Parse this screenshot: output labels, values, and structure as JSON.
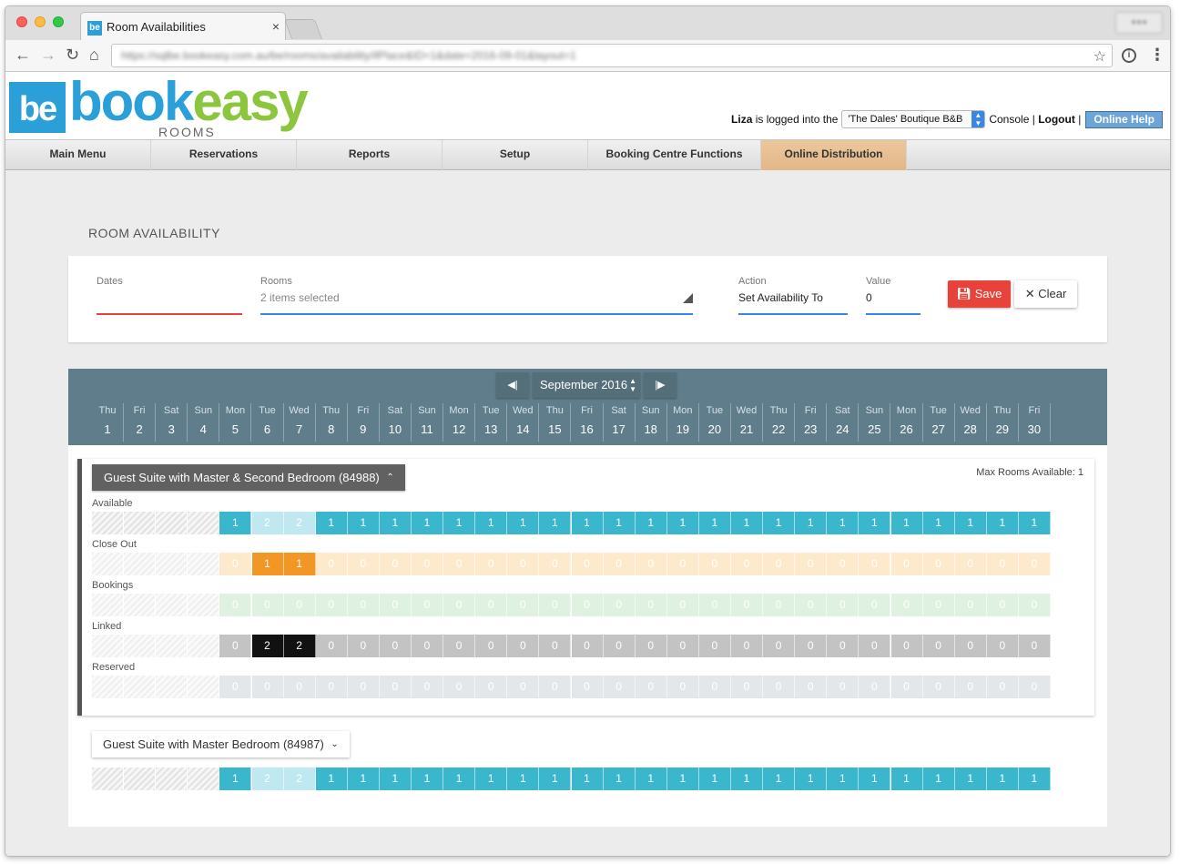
{
  "browser": {
    "tab_title": "Room Availabilities",
    "tab_favicon": "be",
    "tab_close": "×",
    "url": "https://sqlbe.bookeasy.com.au/be/rooms/availability/ifPlace&ID=1&date=2016-09-01&layout=1"
  },
  "header": {
    "logo_mark": "be",
    "logo_book": "book",
    "logo_easy": "easy",
    "logo_sub": "ROOMS",
    "user": "Liza",
    "logged_text": "is logged into the",
    "property": "'The Dales' Boutique B&B",
    "console": "Console",
    "separator": "|",
    "logout": "Logout",
    "help": "Online Help"
  },
  "nav": {
    "items": [
      "Main Menu",
      "Reservations",
      "Reports",
      "Setup",
      "Booking Centre Functions",
      "Online Distribution"
    ],
    "active_index": 5
  },
  "page": {
    "title": "ROOM AVAILABILITY"
  },
  "filters": {
    "dates_label": "Dates",
    "rooms_label": "Rooms",
    "rooms_placeholder": "2 items selected",
    "action_label": "Action",
    "action_value": "Set Availability To",
    "value_label": "Value",
    "value_value": "0",
    "save_label": "Save",
    "clear_label": "Clear"
  },
  "calendar": {
    "month": "September 2016",
    "prev_icon": "first-page-icon",
    "next_icon": "last-page-icon",
    "days": [
      {
        "name": "Thu",
        "num": "1"
      },
      {
        "name": "Fri",
        "num": "2"
      },
      {
        "name": "Sat",
        "num": "3"
      },
      {
        "name": "Sun",
        "num": "4"
      },
      {
        "name": "Mon",
        "num": "5"
      },
      {
        "name": "Tue",
        "num": "6"
      },
      {
        "name": "Wed",
        "num": "7"
      },
      {
        "name": "Thu",
        "num": "8"
      },
      {
        "name": "Fri",
        "num": "9"
      },
      {
        "name": "Sat",
        "num": "10"
      },
      {
        "name": "Sun",
        "num": "11"
      },
      {
        "name": "Mon",
        "num": "12"
      },
      {
        "name": "Tue",
        "num": "13"
      },
      {
        "name": "Wed",
        "num": "14"
      },
      {
        "name": "Thu",
        "num": "15"
      },
      {
        "name": "Fri",
        "num": "16"
      },
      {
        "name": "Sat",
        "num": "17"
      },
      {
        "name": "Sun",
        "num": "18"
      },
      {
        "name": "Mon",
        "num": "19"
      },
      {
        "name": "Tue",
        "num": "20"
      },
      {
        "name": "Wed",
        "num": "21"
      },
      {
        "name": "Thu",
        "num": "22"
      },
      {
        "name": "Fri",
        "num": "23"
      },
      {
        "name": "Sat",
        "num": "24"
      },
      {
        "name": "Sun",
        "num": "25"
      },
      {
        "name": "Mon",
        "num": "26"
      },
      {
        "name": "Tue",
        "num": "27"
      },
      {
        "name": "Wed",
        "num": "28"
      },
      {
        "name": "Thu",
        "num": "29"
      },
      {
        "name": "Fri",
        "num": "30"
      }
    ]
  },
  "rooms": [
    {
      "name": "Guest Suite with Master & Second Bedroom (84988)",
      "expanded": true,
      "max_rooms": "Max Rooms Available: 1",
      "rows": [
        {
          "label": "Available",
          "type": "available",
          "values": [
            "",
            "",
            "",
            "",
            "1",
            "2",
            "2",
            "1",
            "1",
            "1",
            "1",
            "1",
            "1",
            "1",
            "1",
            "1",
            "1",
            "1",
            "1",
            "1",
            "1",
            "1",
            "1",
            "1",
            "1",
            "1",
            "1",
            "1",
            "1",
            "1"
          ]
        },
        {
          "label": "Close Out",
          "type": "closeout",
          "values": [
            "",
            "",
            "",
            "",
            "0",
            "1",
            "1",
            "0",
            "0",
            "0",
            "0",
            "0",
            "0",
            "0",
            "0",
            "0",
            "0",
            "0",
            "0",
            "0",
            "0",
            "0",
            "0",
            "0",
            "0",
            "0",
            "0",
            "0",
            "0",
            "0"
          ]
        },
        {
          "label": "Bookings",
          "type": "bookings",
          "values": [
            "",
            "",
            "",
            "",
            "0",
            "0",
            "0",
            "0",
            "0",
            "0",
            "0",
            "0",
            "0",
            "0",
            "0",
            "0",
            "0",
            "0",
            "0",
            "0",
            "0",
            "0",
            "0",
            "0",
            "0",
            "0",
            "0",
            "0",
            "0",
            "0"
          ]
        },
        {
          "label": "Linked",
          "type": "linked",
          "values": [
            "",
            "",
            "",
            "",
            "0",
            "2",
            "2",
            "0",
            "0",
            "0",
            "0",
            "0",
            "0",
            "0",
            "0",
            "0",
            "0",
            "0",
            "0",
            "0",
            "0",
            "0",
            "0",
            "0",
            "0",
            "0",
            "0",
            "0",
            "0",
            "0"
          ]
        },
        {
          "label": "Reserved",
          "type": "reserved",
          "values": [
            "",
            "",
            "",
            "",
            "0",
            "0",
            "0",
            "0",
            "0",
            "0",
            "0",
            "0",
            "0",
            "0",
            "0",
            "0",
            "0",
            "0",
            "0",
            "0",
            "0",
            "0",
            "0",
            "0",
            "0",
            "0",
            "0",
            "0",
            "0",
            "0"
          ]
        }
      ]
    },
    {
      "name": "Guest Suite with Master Bedroom (84987)",
      "expanded": false,
      "rows": [
        {
          "label": "",
          "type": "available",
          "values": [
            "",
            "",
            "",
            "",
            "1",
            "2",
            "2",
            "1",
            "1",
            "1",
            "1",
            "1",
            "1",
            "1",
            "1",
            "1",
            "1",
            "1",
            "1",
            "1",
            "1",
            "1",
            "1",
            "1",
            "1",
            "1",
            "1",
            "1",
            "1",
            "1"
          ]
        }
      ]
    }
  ],
  "colors": {
    "available": "#3ab7cc",
    "available_light": "#bfe8f0",
    "closeout_light": "#fde9cc",
    "closeout_active": "#f29625",
    "bookings": "#dff1e0",
    "linked": "#c3c3c3",
    "linked_active": "#111111",
    "reserved": "#e4e7e9",
    "calendar_bar": "#607d8b",
    "save": "#e8433a"
  }
}
